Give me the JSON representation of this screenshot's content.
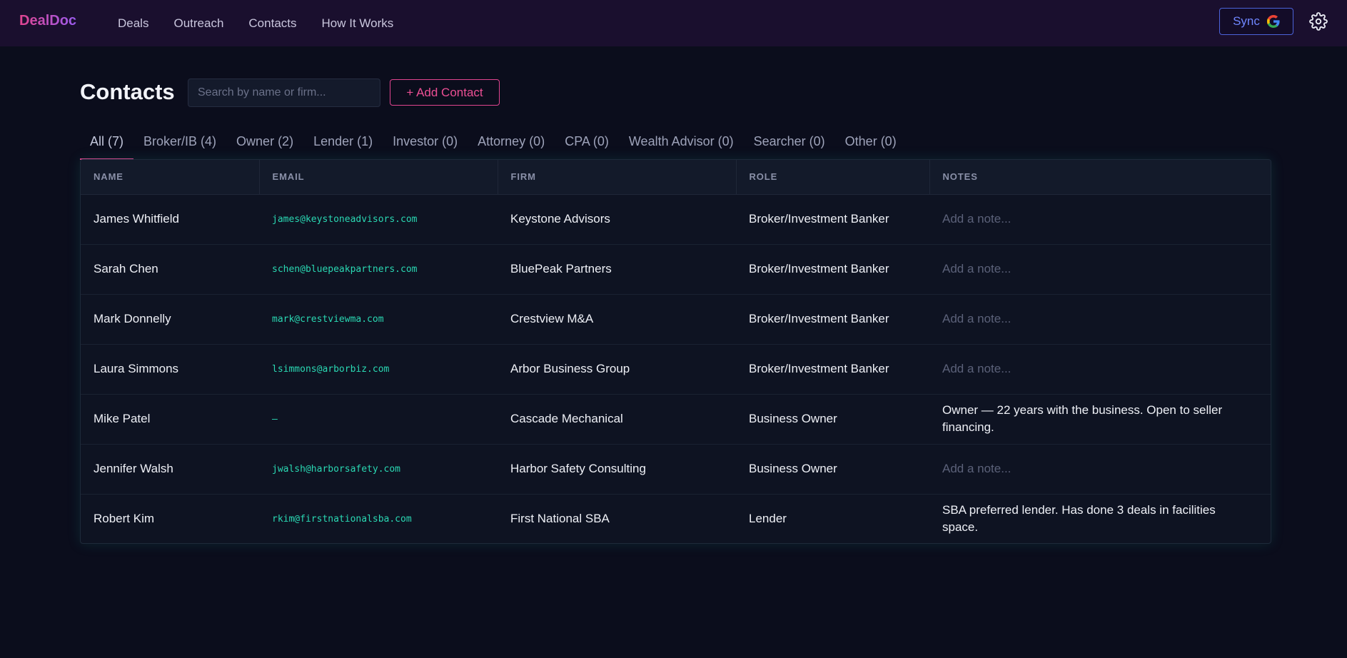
{
  "app": {
    "logo": "DealDoc"
  },
  "nav": {
    "links": [
      "Deals",
      "Outreach",
      "Contacts",
      "How It Works"
    ],
    "sync_label": "Sync"
  },
  "page": {
    "title": "Contacts",
    "search_placeholder": "Search by name or firm...",
    "add_button": "+ Add Contact"
  },
  "tabs": [
    {
      "label": "All (7)",
      "active": true
    },
    {
      "label": "Broker/IB (4)"
    },
    {
      "label": "Owner (2)"
    },
    {
      "label": "Lender (1)"
    },
    {
      "label": "Investor (0)"
    },
    {
      "label": "Attorney (0)"
    },
    {
      "label": "CPA (0)"
    },
    {
      "label": "Wealth Advisor (0)"
    },
    {
      "label": "Searcher (0)"
    },
    {
      "label": "Other (0)"
    }
  ],
  "table": {
    "columns": [
      "NAME",
      "EMAIL",
      "FIRM",
      "ROLE",
      "NOTES"
    ],
    "note_placeholder": "Add a note...",
    "rows": [
      {
        "name": "James Whitfield",
        "email": "james@keystoneadvisors.com",
        "firm": "Keystone Advisors",
        "role": "Broker/Investment Banker",
        "notes": ""
      },
      {
        "name": "Sarah Chen",
        "email": "schen@bluepeakpartners.com",
        "firm": "BluePeak Partners",
        "role": "Broker/Investment Banker",
        "notes": ""
      },
      {
        "name": "Mark Donnelly",
        "email": "mark@crestviewma.com",
        "firm": "Crestview M&A",
        "role": "Broker/Investment Banker",
        "notes": ""
      },
      {
        "name": "Laura Simmons",
        "email": "lsimmons@arborbiz.com",
        "firm": "Arbor Business Group",
        "role": "Broker/Investment Banker",
        "notes": ""
      },
      {
        "name": "Mike Patel",
        "email": "—",
        "firm": "Cascade Mechanical",
        "role": "Business Owner",
        "notes": "Owner — 22 years with the business. Open to seller financing."
      },
      {
        "name": "Jennifer Walsh",
        "email": "jwalsh@harborsafety.com",
        "firm": "Harbor Safety Consulting",
        "role": "Business Owner",
        "notes": ""
      },
      {
        "name": "Robert Kim",
        "email": "rkim@firstnationalsba.com",
        "firm": "First National SBA",
        "role": "Lender",
        "notes": "SBA preferred lender. Has done 3 deals in facilities space."
      }
    ]
  },
  "colors": {
    "accent": "#e0448f",
    "email": "#2ad8b3",
    "sync": "#6f86ff"
  }
}
